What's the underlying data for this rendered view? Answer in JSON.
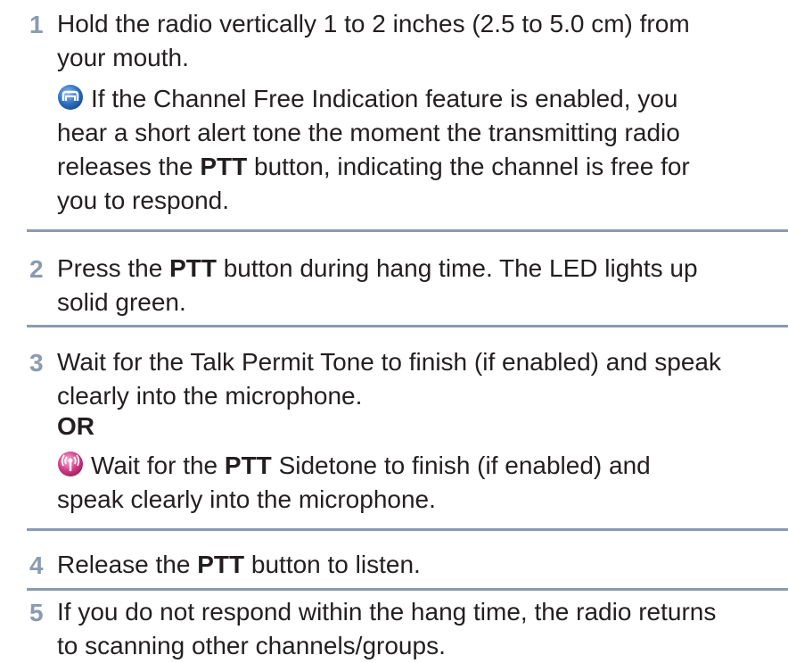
{
  "steps": [
    {
      "number": "1",
      "lines": [
        "Hold the radio vertically 1 to 2 inches (2.5 to 5.0 cm) from",
        "your mouth."
      ],
      "note": {
        "icon": "channel-free-icon",
        "lines": [
          "If the Channel Free Indication feature is enabled, you",
          "hear a short alert tone the moment the transmitting radio"
        ],
        "line3_a": "releases the ",
        "line3_bold": "PTT",
        "line3_b": " button, indicating the channel is free for",
        "line4": "you to respond."
      }
    },
    {
      "number": "2",
      "line1_a": "Press the ",
      "line1_bold": "PTT",
      "line1_b": " button during hang time. The LED lights up",
      "line2": "solid green."
    },
    {
      "number": "3",
      "lines": [
        "Wait for the Talk Permit Tone to finish (if enabled) and speak",
        "clearly into the microphone."
      ],
      "or_label": "OR",
      "note": {
        "icon": "sidetone-icon",
        "line1_a": "Wait for the ",
        "line1_bold": "PTT",
        "line1_b": " Sidetone to finish (if enabled) and",
        "line2": "speak clearly into the microphone."
      }
    },
    {
      "number": "4",
      "line1_a": "Release the ",
      "line1_bold": "PTT",
      "line1_b": " button to listen."
    },
    {
      "number": "5",
      "lines": [
        "If you do not respond within the hang time, the radio returns",
        "to scanning other channels/groups."
      ]
    }
  ],
  "colors": {
    "step_number": "#8a9bb0",
    "divider": "#8a9bb0",
    "text": "#231f20",
    "channel_free_icon": "#2f6fc0",
    "sidetone_icon": "#d23a86"
  }
}
